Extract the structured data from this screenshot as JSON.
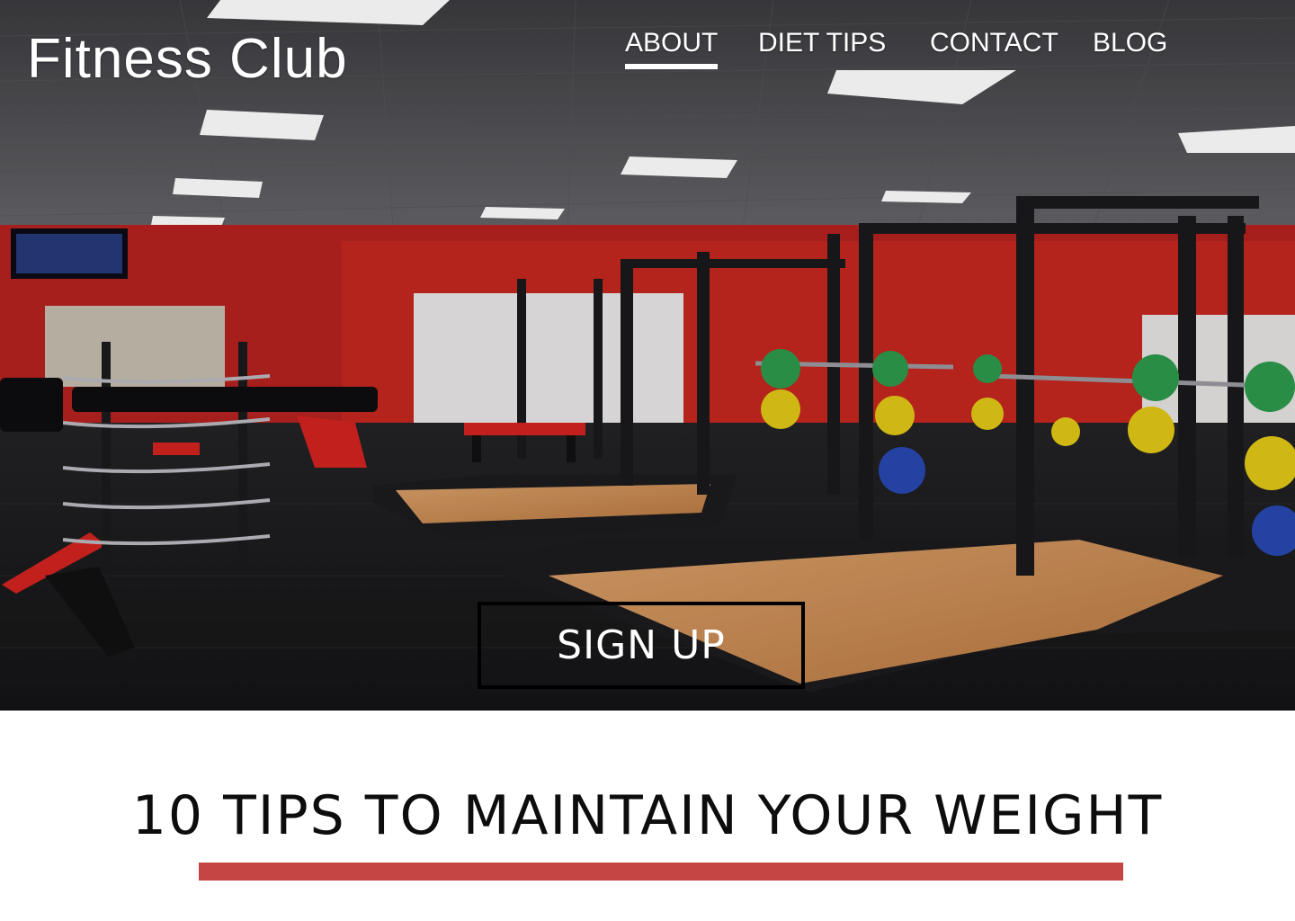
{
  "site": {
    "logo_text": "Fitness Club"
  },
  "nav": {
    "items": [
      {
        "label": "ABOUT",
        "active": true
      },
      {
        "label": "DIET TIPS",
        "active": false
      },
      {
        "label": "CONTACT",
        "active": false
      },
      {
        "label": "BLOG",
        "active": false
      }
    ]
  },
  "hero": {
    "image_subject": "gym interior with squat racks, weight plates and benches",
    "cta_label": "SIGN UP"
  },
  "article": {
    "title": "10 TIPS TO MAINTAIN YOUR WEIGHT"
  },
  "colors": {
    "accent_rule": "#c54544",
    "nav_text": "#ffffff",
    "title_text": "#0d0d0d"
  }
}
